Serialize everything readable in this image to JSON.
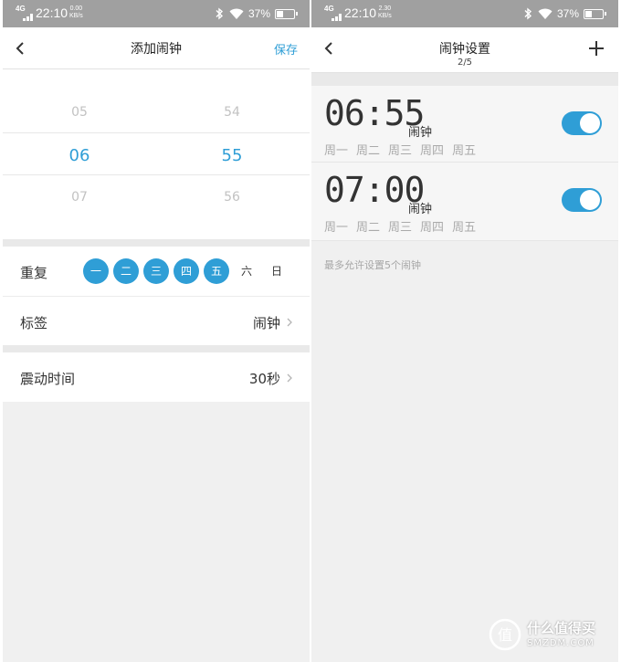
{
  "left_phone": {
    "status": {
      "network": "4G",
      "time": "22:10",
      "speed_value": "0.00",
      "speed_unit": "KB/s",
      "battery": "37%"
    },
    "nav": {
      "title": "添加闹钟",
      "save_label": "保存"
    },
    "picker": {
      "hour_prev": "05",
      "hour_selected": "06",
      "hour_next": "07",
      "minute_prev": "54",
      "minute_selected": "55",
      "minute_next": "56"
    },
    "repeat": {
      "label": "重复",
      "days": [
        {
          "label": "一",
          "selected": true
        },
        {
          "label": "二",
          "selected": true
        },
        {
          "label": "三",
          "selected": true
        },
        {
          "label": "四",
          "selected": true
        },
        {
          "label": "五",
          "selected": true
        },
        {
          "label": "六",
          "selected": false
        },
        {
          "label": "日",
          "selected": false
        }
      ]
    },
    "tag": {
      "label": "标签",
      "value": "闹钟"
    },
    "vibrate": {
      "label": "震动时间",
      "value": "30秒"
    }
  },
  "right_phone": {
    "status": {
      "network": "4G",
      "time": "22:10",
      "speed_value": "2.30",
      "speed_unit": "KB/s",
      "battery": "37%"
    },
    "nav": {
      "title": "闹钟设置",
      "subtitle": "2/5"
    },
    "alarms": [
      {
        "time": "06:55",
        "label": "闹钟",
        "days": [
          "周一",
          "周二",
          "周三",
          "周四",
          "周五"
        ],
        "enabled": true
      },
      {
        "time": "07:00",
        "label": "闹钟",
        "days": [
          "周一",
          "周二",
          "周三",
          "周四",
          "周五"
        ],
        "enabled": true
      }
    ],
    "note": "最多允许设置5个闹钟"
  },
  "watermark": {
    "text": "什么值得买",
    "sub": "SMZDM.COM",
    "logo_char": "值"
  },
  "colors": {
    "accent": "#2f9ed6",
    "status_bar": "#a0a0a0",
    "page_bg": "#f0f0f0"
  }
}
